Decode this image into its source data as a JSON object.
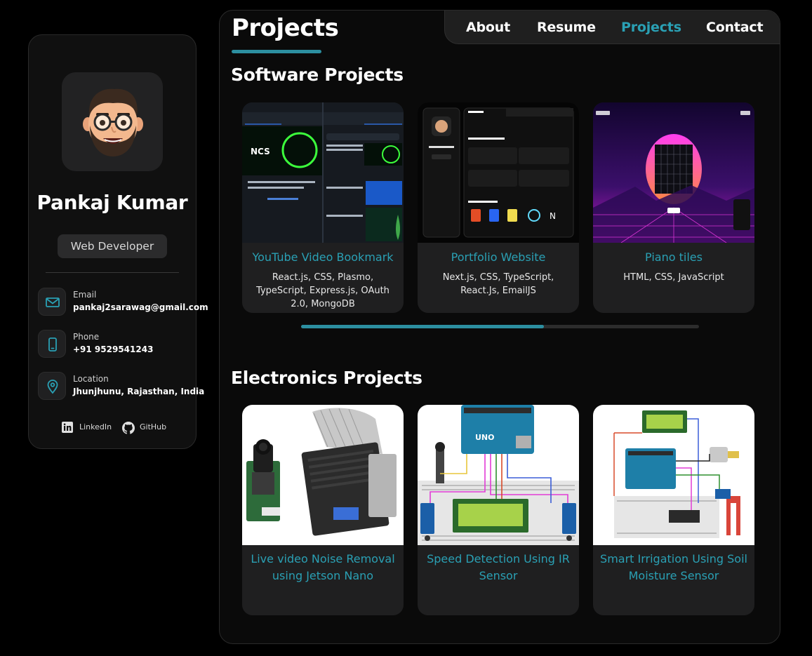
{
  "profile": {
    "name": "Pankaj Kumar",
    "role": "Web Developer",
    "contacts": [
      {
        "label": "Email",
        "value": "pankaj2sarawag@gmail.com",
        "icon": "mail-icon"
      },
      {
        "label": "Phone",
        "value": "+91 9529541243",
        "icon": "phone-icon"
      },
      {
        "label": "Location",
        "value": "Jhunjhunu, Rajasthan, India",
        "icon": "location-pin-icon"
      }
    ],
    "social": [
      {
        "label": "LinkedIn",
        "icon": "linkedin-icon"
      },
      {
        "label": "GitHub",
        "icon": "github-icon"
      }
    ]
  },
  "page": {
    "title": "Projects"
  },
  "nav": {
    "items": [
      "About",
      "Resume",
      "Projects",
      "Contact"
    ],
    "active": "Projects"
  },
  "software": {
    "title": "Software Projects",
    "projects": [
      {
        "title": "YouTube Video Bookmark",
        "tech": "React.js, CSS, Plasmo, TypeScript, Express.js, OAuth 2.0, MongoDB"
      },
      {
        "title": "Portfolio Website",
        "tech": "Next.js, CSS, TypeScript, React.Js, EmailJS"
      },
      {
        "title": "Piano tiles",
        "tech": "HTML, CSS, JavaScript"
      }
    ],
    "scroll_progress": 0.61
  },
  "electronics": {
    "title": "Electronics Projects",
    "projects": [
      {
        "title": "Live video Noise Removal using Jetson Nano"
      },
      {
        "title": "Speed Detection Using IR Sensor"
      },
      {
        "title": "Smart Irrigation Using Soil Moisture Sensor"
      }
    ]
  },
  "colors": {
    "accent": "#2aa0b4",
    "background": "#000000",
    "card": "#1f1f20",
    "panel": "#101010"
  }
}
